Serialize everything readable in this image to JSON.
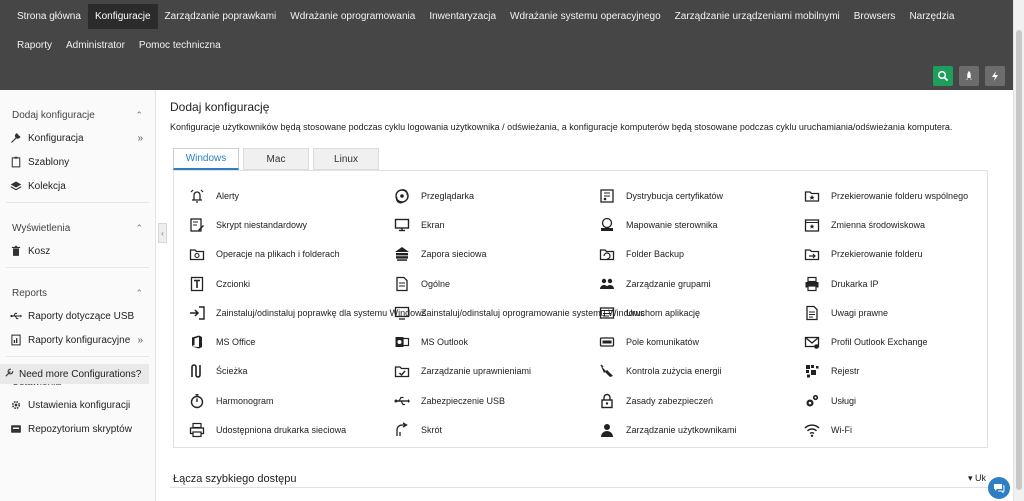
{
  "nav": {
    "items": [
      {
        "label": "Strona główna",
        "active": false
      },
      {
        "label": "Konfiguracje",
        "active": true
      },
      {
        "label": "Zarządzanie poprawkami",
        "active": false
      },
      {
        "label": "Wdrażanie oprogramowania",
        "active": false
      },
      {
        "label": "Inwentaryzacja",
        "active": false
      },
      {
        "label": "Wdrażanie systemu operacyjnego",
        "active": false
      },
      {
        "label": "Zarządzanie urządzeniami mobilnymi",
        "active": false
      },
      {
        "label": "Browsers",
        "active": false
      },
      {
        "label": "Narzędzia",
        "active": false
      },
      {
        "label": "Raporty",
        "active": false
      },
      {
        "label": "Administrator",
        "active": false
      },
      {
        "label": "Pomoc techniczna",
        "active": false
      }
    ],
    "buttons": [
      {
        "icon": "search-icon"
      },
      {
        "icon": "rocket-icon"
      },
      {
        "icon": "lightning-icon"
      }
    ]
  },
  "sidebar": {
    "sections": [
      {
        "title": "Dodaj konfiguracje",
        "items": [
          {
            "label": "Konfiguracja",
            "icon": "wrench-icon",
            "arrow": "»"
          },
          {
            "label": "Szablony",
            "icon": "clipboard-icon",
            "arrow": ""
          },
          {
            "label": "Kolekcja",
            "icon": "layers-icon",
            "arrow": ""
          }
        ]
      },
      {
        "title": "Wyświetlenia",
        "items": [
          {
            "label": "Kosz",
            "icon": "trash-icon",
            "arrow": ""
          }
        ]
      },
      {
        "title": "Reports",
        "items": [
          {
            "label": "Raporty dotyczące USB",
            "icon": "usb-icon",
            "arrow": ""
          },
          {
            "label": "Raporty konfiguracyjne",
            "icon": "report-icon",
            "arrow": "»"
          }
        ]
      },
      {
        "title": "Ustawienia",
        "items": [
          {
            "label": "Ustawienia konfiguracji",
            "icon": "gear-icon",
            "arrow": ""
          },
          {
            "label": "Repozytorium skryptów",
            "icon": "repository-icon",
            "arrow": ""
          }
        ]
      }
    ],
    "need_more": "Need more Configurations?"
  },
  "main": {
    "title": "Dodaj konfigurację",
    "description": "Konfiguracje użytkowników będą stosowane podczas cyklu logowania użytkownika / odświeżania, a konfiguracje komputerów będą stosowane podczas cyklu uruchamiania/odświeżania komputera.",
    "tabs": [
      {
        "label": "Windows",
        "active": true
      },
      {
        "label": "Mac",
        "active": false
      },
      {
        "label": "Linux",
        "active": false
      }
    ],
    "configs": [
      {
        "label": "Alerty",
        "icon": "bell-icon"
      },
      {
        "label": "Przeglądarka",
        "icon": "browser-icon"
      },
      {
        "label": "Dystrybucja certyfikatów",
        "icon": "certificate-icon"
      },
      {
        "label": "Przekierowanie folderu wspólnego",
        "icon": "shared-folder-icon"
      },
      {
        "label": "Skrypt niestandardowy",
        "icon": "script-icon"
      },
      {
        "label": "Ekran",
        "icon": "monitor-icon"
      },
      {
        "label": "Mapowanie sterownika",
        "icon": "drive-map-icon"
      },
      {
        "label": "Zmienna środowiskowa",
        "icon": "env-variable-icon"
      },
      {
        "label": "Operacje na plikach i folderach",
        "icon": "file-folder-icon"
      },
      {
        "label": "Zapora sieciowa",
        "icon": "firewall-icon"
      },
      {
        "label": "Folder Backup",
        "icon": "folder-backup-icon"
      },
      {
        "label": "Przekierowanie folderu",
        "icon": "folder-redirect-icon"
      },
      {
        "label": "Czcionki",
        "icon": "font-icon"
      },
      {
        "label": "Ogólne",
        "icon": "document-icon"
      },
      {
        "label": "Zarządzanie grupami",
        "icon": "group-icon"
      },
      {
        "label": "Drukarka IP",
        "icon": "printer-icon"
      },
      {
        "label": "Zainstaluj/odinstaluj poprawkę dla systemu Windows",
        "icon": "patch-install-icon"
      },
      {
        "label": "Zainstaluj/odinstaluj oprogramowanie systemu Windows",
        "icon": "software-install-icon"
      },
      {
        "label": "Uruchom aplikację",
        "icon": "launch-app-icon"
      },
      {
        "label": "Uwagi prawne",
        "icon": "legal-notice-icon"
      },
      {
        "label": "MS Office",
        "icon": "ms-office-icon"
      },
      {
        "label": "MS Outlook",
        "icon": "ms-outlook-icon"
      },
      {
        "label": "Pole komunikatów",
        "icon": "message-box-icon"
      },
      {
        "label": "Profil Outlook Exchange",
        "icon": "outlook-profile-icon"
      },
      {
        "label": "Ścieżka",
        "icon": "path-icon"
      },
      {
        "label": "Zarządzanie uprawnieniami",
        "icon": "permission-icon"
      },
      {
        "label": "Kontrola zużycia energii",
        "icon": "power-plug-icon"
      },
      {
        "label": "Rejestr",
        "icon": "registry-icon"
      },
      {
        "label": "Harmonogram",
        "icon": "stopwatch-icon"
      },
      {
        "label": "Zabezpieczenie USB",
        "icon": "usb-icon"
      },
      {
        "label": "Zasady zabezpieczeń",
        "icon": "lock-icon"
      },
      {
        "label": "Usługi",
        "icon": "services-icon"
      },
      {
        "label": "Udostępniona drukarka sieciowa",
        "icon": "shared-printer-icon"
      },
      {
        "label": "Skrót",
        "icon": "shortcut-icon"
      },
      {
        "label": "Zarządzanie użytkownikami",
        "icon": "user-icon"
      },
      {
        "label": "Wi-Fi",
        "icon": "wifi-icon"
      }
    ],
    "quick_access": "Łącza szybkiego dostępu",
    "quick_toggle": "▾ Uk"
  },
  "colors": {
    "topbar": "#464646",
    "active_nav": "#2b2b2b",
    "accent": "#2d7ec2",
    "search_btn": "#1e9e5c"
  }
}
